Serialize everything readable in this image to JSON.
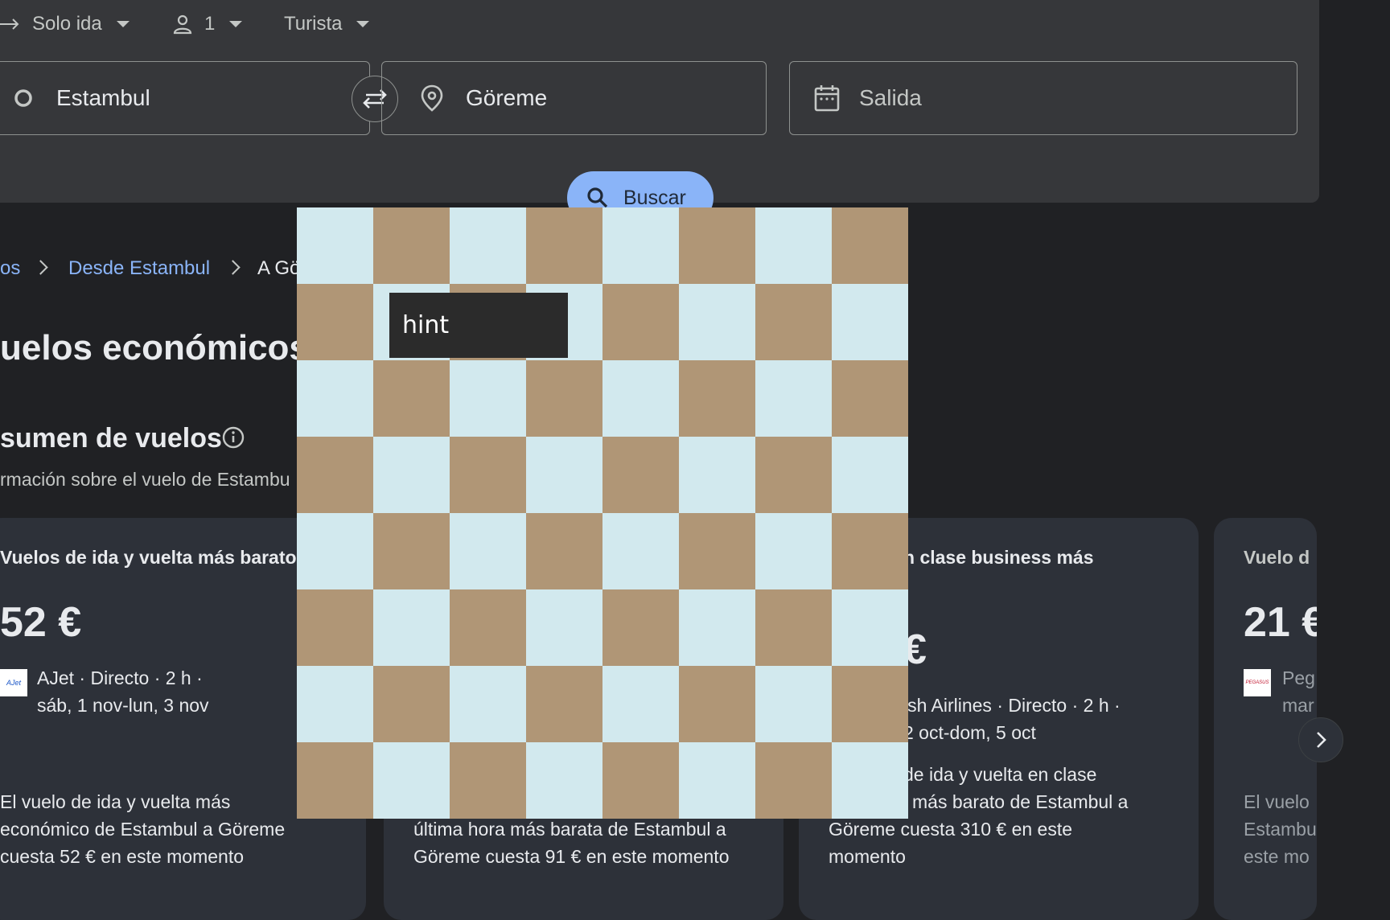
{
  "options": {
    "trip_type": "Solo ida",
    "passengers": "1",
    "cabin": "Turista"
  },
  "fields": {
    "origin": "Estambul",
    "destination": "Göreme",
    "departure_placeholder": "Salida"
  },
  "search_button": "Buscar",
  "breadcrumb": {
    "prev": "os",
    "from": "Desde Estambul",
    "to": "A Gö"
  },
  "page_title": "uelos económicos de",
  "summary": {
    "heading": "sumen de vuelos",
    "subtitle": "rmación sobre el vuelo de Estambu"
  },
  "cards": [
    {
      "title": "Vuelos de ida y vuelta más barato",
      "price": "52 €",
      "logo": "AJet",
      "line1": "AJet · Directo · 2 h ·",
      "line2": "sáb, 1 nov-lun, 3 nov",
      "desc1": "El vuelo de ida y vuelta más",
      "desc2": "económico de Estambul a Göreme",
      "desc3": "cuesta 52 € en este momento"
    },
    {
      "desc1": "última hora más barata de Estambul a",
      "desc2": "Göreme cuesta 91 € en este momento"
    },
    {
      "title": "n clase business más",
      "price": "€",
      "line1": "ish Airlines · Directo · 2 h ·",
      "line2": "2 oct-dom, 5 oct",
      "desc1": "de ida y vuelta en clase",
      "desc2": "más barato de Estambul a",
      "desc3": "Göreme cuesta 310 € en este",
      "desc4": "momento"
    },
    {
      "title": "Vuelo d",
      "price": "21 €",
      "logo": "PEGASUS",
      "line1": "Peg",
      "line2": "mar",
      "desc1": "El vuelo",
      "desc2": "Estambu",
      "desc3": "este mo"
    }
  ],
  "overlay": {
    "hint": "hint",
    "light_color": "#d2e9ee",
    "dark_color": "#b09676"
  }
}
